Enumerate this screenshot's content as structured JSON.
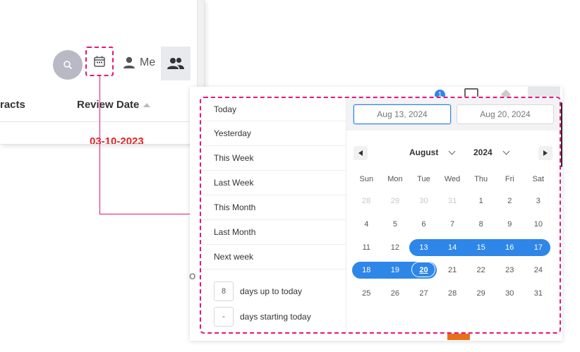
{
  "toolbar": {
    "me_label": "Me"
  },
  "table": {
    "col_contracts": "racts",
    "col_review_date": "Review Date",
    "review_value": "03-10-2023"
  },
  "peek": {
    "badge": "1",
    "letter": "O"
  },
  "presets": [
    "Today",
    "Yesterday",
    "This Week",
    "Last Week",
    "This Month",
    "Last Month",
    "Next week"
  ],
  "relative": {
    "up_to_today": {
      "value": "8",
      "label": "days up to today"
    },
    "starting_today": {
      "value": "-",
      "label": "days starting today"
    }
  },
  "range": {
    "start": "Aug 13, 2024",
    "end": "Aug 20, 2024"
  },
  "calendar": {
    "month": "August",
    "year": "2024",
    "weekdays": [
      "Sun",
      "Mon",
      "Tue",
      "Wed",
      "Thu",
      "Fri",
      "Sat"
    ],
    "weeks": [
      [
        "28",
        "29",
        "30",
        "31",
        "1",
        "2",
        "3"
      ],
      [
        "4",
        "5",
        "6",
        "7",
        "8",
        "9",
        "10"
      ],
      [
        "11",
        "12",
        "13",
        "14",
        "15",
        "16",
        "17"
      ],
      [
        "18",
        "19",
        "20",
        "21",
        "22",
        "23",
        "24"
      ],
      [
        "25",
        "26",
        "27",
        "28",
        "29",
        "30",
        "31"
      ]
    ]
  },
  "colors": {
    "accent": "#2e86e8",
    "highlight": "#e6157c",
    "alert": "#e02424"
  }
}
